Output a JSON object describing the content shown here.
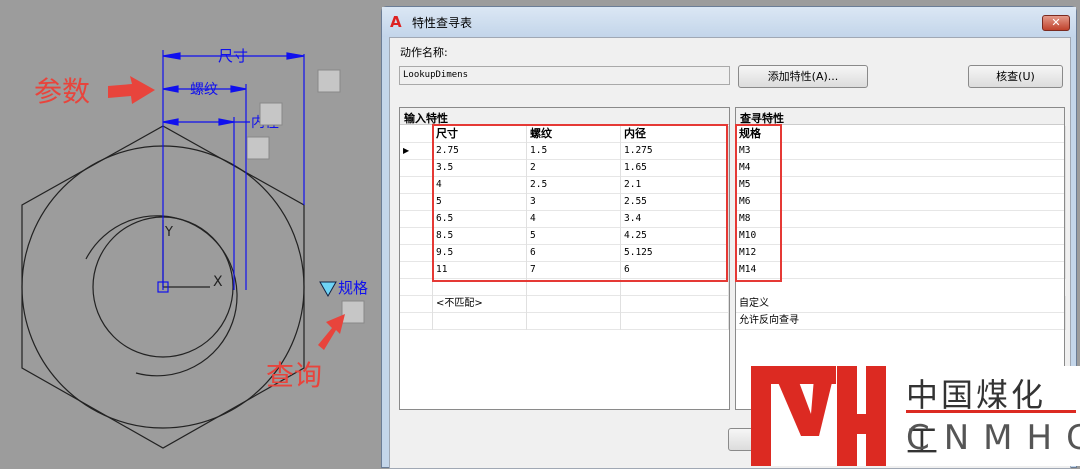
{
  "drawing": {
    "dim_size": "尺寸",
    "dim_thread": "螺纹",
    "dim_inner": "内径",
    "axis_y": "Y",
    "axis_x": "X",
    "lookup_label": "规格",
    "annotation_params": "参数",
    "annotation_lookup": "查询"
  },
  "dialog": {
    "title": "特性查寻表",
    "close": "✕",
    "action_name_label": "动作名称:",
    "action_name_value": "LookupDimens",
    "add_property_button": "添加特性(A)...",
    "audit_button": "核查(U)",
    "input_section": "输入特性",
    "lookup_section": "查寻特性",
    "input_columns": [
      "尺寸",
      "螺纹",
      "内径"
    ],
    "input_rows": [
      [
        "2.75",
        "1.5",
        "1.275"
      ],
      [
        "3.5",
        "2",
        "1.65"
      ],
      [
        "4",
        "2.5",
        "2.1"
      ],
      [
        "5",
        "3",
        "2.55"
      ],
      [
        "6.5",
        "4",
        "3.4"
      ],
      [
        "8.5",
        "5",
        "4.25"
      ],
      [
        "9.5",
        "6",
        "5.125"
      ],
      [
        "11",
        "7",
        "6"
      ]
    ],
    "unmatched": "<不匹配>",
    "lookup_column": "规格",
    "lookup_rows": [
      "M3",
      "M4",
      "M5",
      "M6",
      "M8",
      "M10",
      "M12",
      "M14"
    ],
    "custom": "自定义",
    "reverse_lookup": "允许反向查寻"
  },
  "logo": {
    "mark": "MH",
    "cn": "中国煤化工",
    "en": "CNMHG"
  }
}
